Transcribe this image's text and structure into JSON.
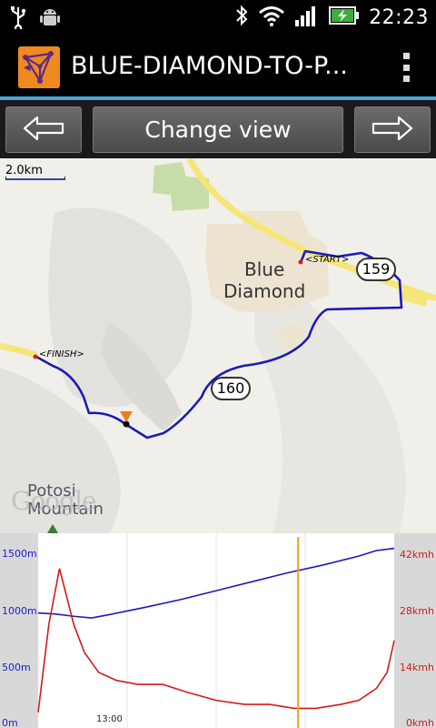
{
  "status_bar": {
    "time": "22:23",
    "icons": [
      "usb-icon",
      "android-debug-icon",
      "bluetooth-icon",
      "wifi-icon",
      "signal-icon",
      "battery-charging-icon"
    ]
  },
  "action_bar": {
    "title": "BLUE-DIAMOND-TO-P...",
    "app_icon": "map-route-app-icon",
    "overflow_icon": "overflow-menu-icon"
  },
  "toolbar": {
    "prev_icon": "left-arrow-icon",
    "change_view_label": "Change view",
    "next_icon": "right-arrow-icon"
  },
  "map": {
    "scale_label": "2.0km",
    "places": {
      "blue_diamond_line1": "Blue",
      "blue_diamond_line2": "Diamond",
      "potosi_line1": "Potosi",
      "potosi_line2": "Mountain"
    },
    "markers": {
      "start": "<START>",
      "finish": "<FINISH>"
    },
    "highways": [
      "159",
      "160"
    ],
    "attribution": "Google",
    "colors": {
      "route": "#1a1ab8",
      "road": "#f5e67a",
      "town": "#ece4d0",
      "park": "#c8dca8"
    }
  },
  "chart": {
    "colors": {
      "elevation": "#1a1ab8",
      "speed": "#d41a1a",
      "cursor": "#f0a020"
    }
  },
  "chart_data": {
    "type": "line",
    "y_left_ticks": [
      "1500m",
      "1000m",
      "500m",
      "0m"
    ],
    "y_right_ticks": [
      "42kmh",
      "28kmh",
      "14kmh",
      "0kmh"
    ],
    "x_ticks": [
      "13:00"
    ],
    "ylim_left": [
      0,
      1650
    ],
    "ylim_right": [
      0,
      46
    ],
    "series": [
      {
        "axis": "left",
        "x": [
          0,
          5,
          10,
          15,
          20,
          30,
          40,
          50,
          60,
          70,
          80,
          90,
          95,
          100
        ],
        "values": [
          1000,
          990,
          970,
          955,
          985,
          1050,
          1120,
          1200,
          1280,
          1360,
          1430,
          1510,
          1560,
          1580
        ]
      },
      {
        "axis": "right",
        "x": [
          0,
          3,
          6,
          10,
          13,
          17,
          22,
          28,
          35,
          42,
          50,
          58,
          65,
          72,
          78,
          85,
          90,
          95,
          98,
          100
        ],
        "values": [
          3,
          25,
          39,
          25,
          18,
          13,
          11,
          10,
          10,
          8,
          6,
          5,
          5,
          4,
          4,
          5,
          6,
          9,
          13,
          21
        ]
      }
    ],
    "cursor_x": 73
  }
}
